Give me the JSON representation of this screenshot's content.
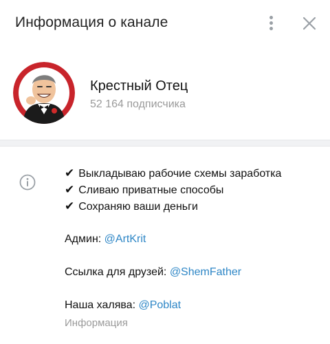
{
  "header": {
    "title": "Информация о канале"
  },
  "channel": {
    "name": "Крестный Отец",
    "subscribers": "52 164 подписчика",
    "avatar_bg": "#c8242b"
  },
  "description": {
    "checks": [
      "Выкладываю рабочие схемы заработка",
      "Сливаю приватные способы",
      "Сохраняю ваши деньги"
    ],
    "check_glyph": "✔",
    "admin_label": "Админ: ",
    "admin_link": "@ArtKrit",
    "friends_label": "Ссылка для друзей: ",
    "friends_link": "@ShemFather",
    "freebie_label": "Наша халява: ",
    "freebie_link": "@Poblat"
  },
  "caption": "Информация",
  "colors": {
    "link": "#2d86c6",
    "muted": "#9a9a9a",
    "icon": "#9aa0a6"
  },
  "icons": [
    "more-vertical-icon",
    "close-icon",
    "info-icon"
  ]
}
